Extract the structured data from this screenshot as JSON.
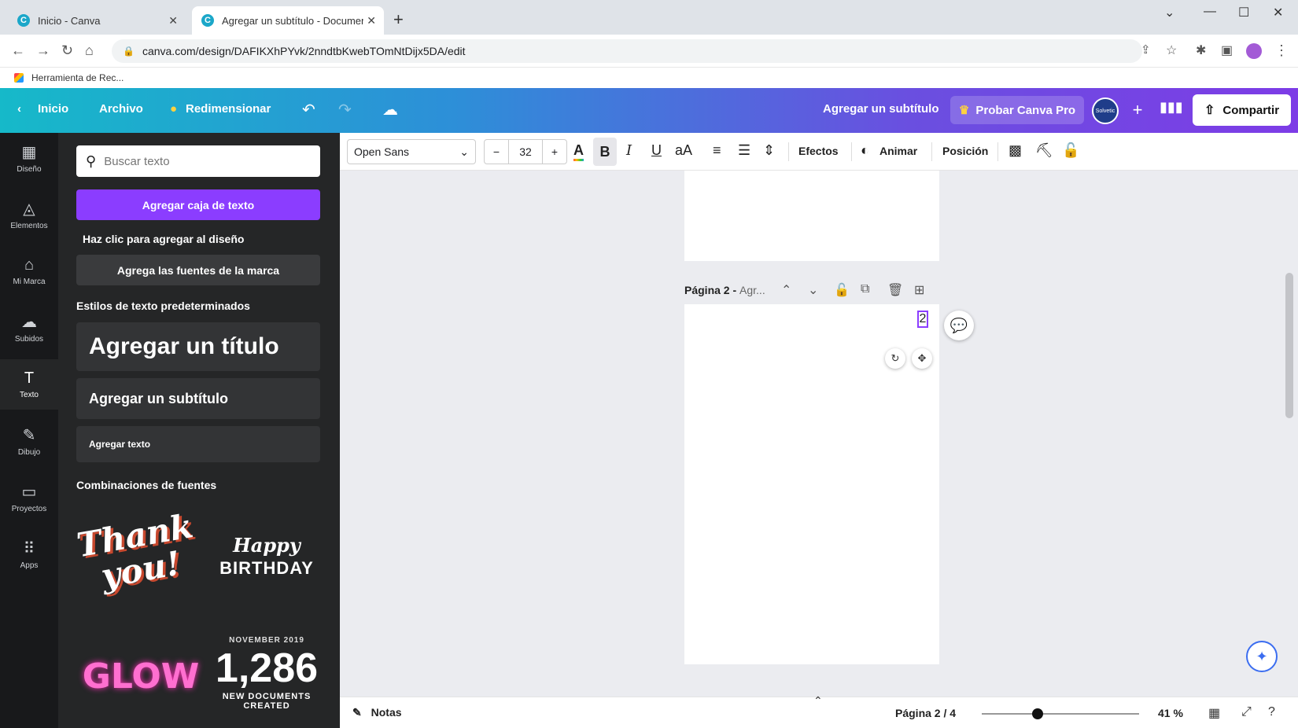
{
  "browser": {
    "tabs": [
      {
        "title": "Inicio - Canva",
        "active": false
      },
      {
        "title": "Agregar un subtítulo - Documen",
        "active": true
      }
    ],
    "url": "canva.com/design/DAFIKXhPYvk/2nndtbKwebTOmNtDijx5DA/edit",
    "bookmark": "Herramienta de Rec..."
  },
  "header": {
    "home": "Inicio",
    "file": "Archivo",
    "resize": "Redimensionar",
    "doc_title": "Agregar un subtítulo",
    "pro": "Probar Canva Pro",
    "share": "Compartir",
    "avatar_text": "Solvetic"
  },
  "rail": [
    {
      "label": "Diseño",
      "icon": "layout-icon"
    },
    {
      "label": "Elementos",
      "icon": "shapes-icon"
    },
    {
      "label": "Mi Marca",
      "icon": "brand-icon"
    },
    {
      "label": "Subidos",
      "icon": "upload-icon"
    },
    {
      "label": "Texto",
      "icon": "text-icon"
    },
    {
      "label": "Dibujo",
      "icon": "draw-icon"
    },
    {
      "label": "Proyectos",
      "icon": "folder-icon"
    },
    {
      "label": "Apps",
      "icon": "apps-icon"
    }
  ],
  "panel": {
    "search_placeholder": "Buscar texto",
    "add_textbox": "Agregar caja de texto",
    "click_hint": "Haz clic para agregar al diseño",
    "brand_fonts": "Agrega las fuentes de la marca",
    "defaults_heading": "Estilos de texto predeterminados",
    "title_style": "Agregar un título",
    "subtitle_style": "Agregar un subtítulo",
    "body_style": "Agregar texto",
    "combos_heading": "Combinaciones de fuentes",
    "combos": [
      {
        "line1": "Thank",
        "line2": "you!"
      },
      {
        "line1": "Happy",
        "line2": "BIRTHDAY"
      },
      {
        "line1": "GLOW"
      },
      {
        "line1": "NOVEMBER 2019",
        "line2": "1,286",
        "line3": "NEW DOCUMENTS",
        "line4": "CREATED"
      }
    ]
  },
  "toolbar": {
    "font": "Open Sans",
    "size": "32",
    "effects": "Efectos",
    "animate": "Animar",
    "position": "Posición"
  },
  "canvas": {
    "page_label": "Página 2 -",
    "page_label_sub": "Agr...",
    "page_number_text": "2"
  },
  "bottom": {
    "notes": "Notas",
    "page_indicator": "Página 2 / 4",
    "zoom": "41 %",
    "zoom_level": 0.41
  },
  "colors": {
    "accent": "#8b3dff",
    "panel_bg": "#252627",
    "rail_bg": "#18191b",
    "canvas_bg": "#ebecf0"
  }
}
